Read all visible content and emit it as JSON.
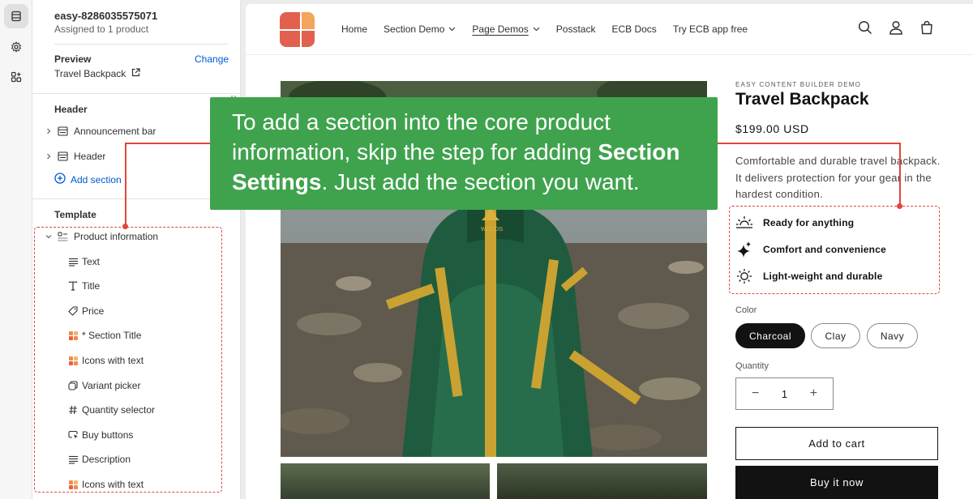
{
  "rail": {
    "icons": [
      "sections-icon",
      "settings-gear-icon",
      "apps-icon"
    ]
  },
  "editor": {
    "template_name": "easy-8286035575071",
    "assigned": "Assigned to 1 product",
    "preview_label": "Preview",
    "change_label": "Change",
    "preview_value": "Travel Backpack",
    "header_group": "Header",
    "header_sections": [
      {
        "label": "Announcement bar"
      },
      {
        "label": "Header"
      }
    ],
    "add_section_label": "Add section",
    "template_group": "Template",
    "main_section": "Product information",
    "blocks": [
      {
        "label": "Text",
        "icon": "text-lines-icon"
      },
      {
        "label": "Title",
        "icon": "title-t-icon"
      },
      {
        "label": "Price",
        "icon": "price-tag-icon"
      },
      {
        "label": "* Section Title",
        "icon": "app-block-icon"
      },
      {
        "label": "Icons with text",
        "icon": "app-block-icon"
      },
      {
        "label": "Variant picker",
        "icon": "variant-picker-icon"
      },
      {
        "label": "Quantity selector",
        "icon": "hash-icon"
      },
      {
        "label": "Buy buttons",
        "icon": "cursor-button-icon"
      },
      {
        "label": "Description",
        "icon": "text-lines-icon"
      },
      {
        "label": "Icons with text",
        "icon": "app-block-icon"
      }
    ]
  },
  "store": {
    "nav": [
      "Home",
      "Section Demo",
      "Page Demos",
      "Posstack",
      "ECB Docs",
      "Try ECB app free"
    ],
    "eyebrow": "EASY CONTENT BUILDER DEMO",
    "title": "Travel Backpack",
    "price": "$199.00 USD",
    "description": "Comfortable and durable travel backpack. It delivers protection for your gear in the hardest condition.",
    "features": [
      {
        "label": "Ready for anything",
        "icon": "sunrise-icon"
      },
      {
        "label": "Comfort and convenience",
        "icon": "sparkle-icon"
      },
      {
        "label": "Light-weight and durable",
        "icon": "sun-icon"
      }
    ],
    "color_label": "Color",
    "colors": [
      "Charcoal",
      "Clay",
      "Navy"
    ],
    "selected_color": "Charcoal",
    "quantity_label": "Quantity",
    "quantity": "1",
    "qty_minus": "−",
    "qty_plus": "+",
    "add_to_cart": "Add to cart",
    "buy_now": "Buy it now",
    "backpack_brand": "WOODS"
  },
  "callout": {
    "part1": "To add a section into the core product information, skip the step for adding ",
    "bold": "Section Settings",
    "part2": ". Just add the section you want."
  },
  "colors": {
    "accent_blue": "#005bd3",
    "annotation_red": "#e0473a",
    "callout_green": "#3fa34d",
    "logo_red": "#e2614e",
    "logo_orange": "#f2a65a"
  }
}
